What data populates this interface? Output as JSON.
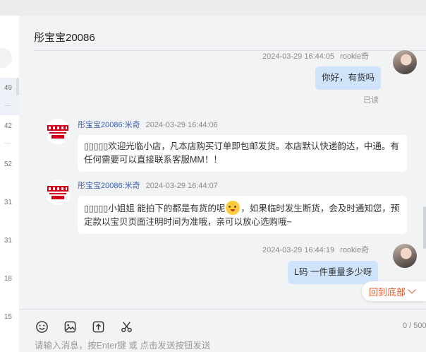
{
  "sidebar": {
    "times": [
      "49",
      "42",
      "52",
      "31",
      "31",
      "18",
      "15"
    ],
    "dots": [
      "...",
      "..."
    ]
  },
  "chat": {
    "title": "彤宝宝20086",
    "messages": [
      {
        "type": "sent",
        "time": "2024-03-29 16:44:05",
        "sender": "rookie奇",
        "text": "你好，有货吗",
        "status": "已读"
      },
      {
        "type": "received",
        "sender": "彤宝宝20086:米奇",
        "time": "2024-03-29 16:44:06",
        "text": "▯▯▯▯▯欢迎光临小店，凡本店购买订单即包邮发货。本店默认快递韵达，中通。有任何需要可以直接联系客服MM！！"
      },
      {
        "type": "received",
        "sender": "彤宝宝20086:米奇",
        "time": "2024-03-29 16:44:07",
        "text_before_emoji": "▯▯▯▯▯小姐姐 能拍下的都是有货的呢",
        "text_after_emoji": "，如果临时发生断货，会及时通知您，预定款以宝贝页面注明时间为准哦，亲可以放心选购哦~"
      },
      {
        "type": "sent",
        "time": "2024-03-29 16:44:19",
        "sender": "rookie奇",
        "text": "L码 一件重量多少呀"
      }
    ],
    "scroll_to_bottom": "回到底部"
  },
  "composer": {
    "counter": "0 / 500",
    "placeholder": "请输入消息，按Enter键 或 点击发送按钮发送",
    "tools": [
      "emoji-icon",
      "image-icon",
      "upload-icon",
      "scissors-icon"
    ]
  },
  "colors": {
    "accent": "#e8572a",
    "sent_bubble": "#cfe3fb",
    "sender_name": "#3a5fb0",
    "shop_logo_red": "#d0021b"
  }
}
